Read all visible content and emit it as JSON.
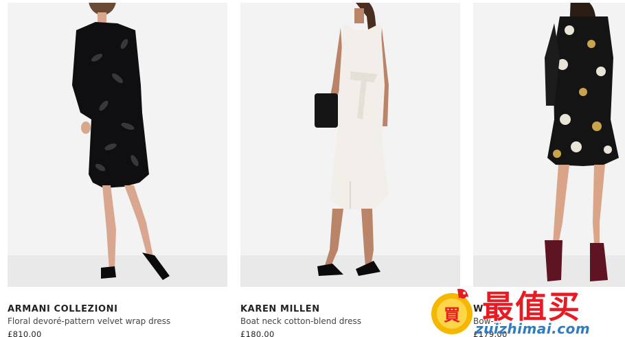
{
  "products": [
    {
      "brand": "ARMANI COLLEZIONI",
      "name": "Floral devoré-pattern velvet wrap dress",
      "price": "£810.00",
      "image_icon": "model-black-velvet-dress"
    },
    {
      "brand": "KAREN MILLEN",
      "name": "Boat neck cotton-blend dress",
      "price": "£180.00",
      "image_icon": "model-white-dress-clutch"
    },
    {
      "brand": "W",
      "name": "Bow-...",
      "price": "£179.00",
      "image_icon": "model-floral-ruffle-dress"
    }
  ],
  "watermark": {
    "chinese": "最值买",
    "url": "zuizhimai.com",
    "colors": {
      "red": "#e61b23",
      "blue": "#2e7cc4",
      "gold": "#f5b800"
    }
  }
}
